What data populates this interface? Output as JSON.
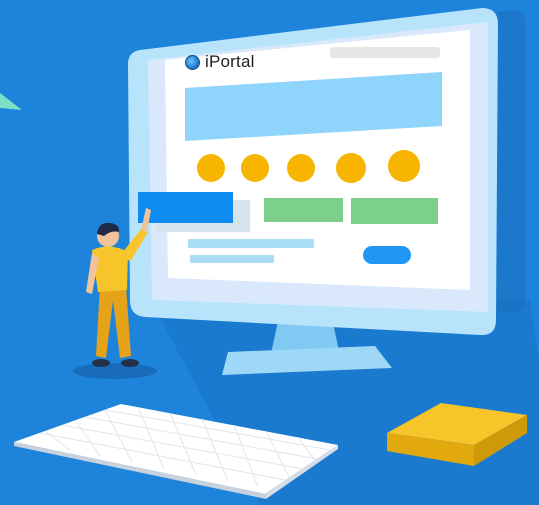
{
  "portal": {
    "brand_name": "iPortal",
    "icon": "globe-icon"
  },
  "colors": {
    "background": "#1e84db",
    "accent": "#f7b500",
    "screen_bg": "#ffffff",
    "banner": "#8fd4fb",
    "button_primary": "#0d8bf0",
    "button_green": "#7dd08c",
    "pill_button": "#2196f3",
    "figure_shirt": "#f7c52a"
  }
}
